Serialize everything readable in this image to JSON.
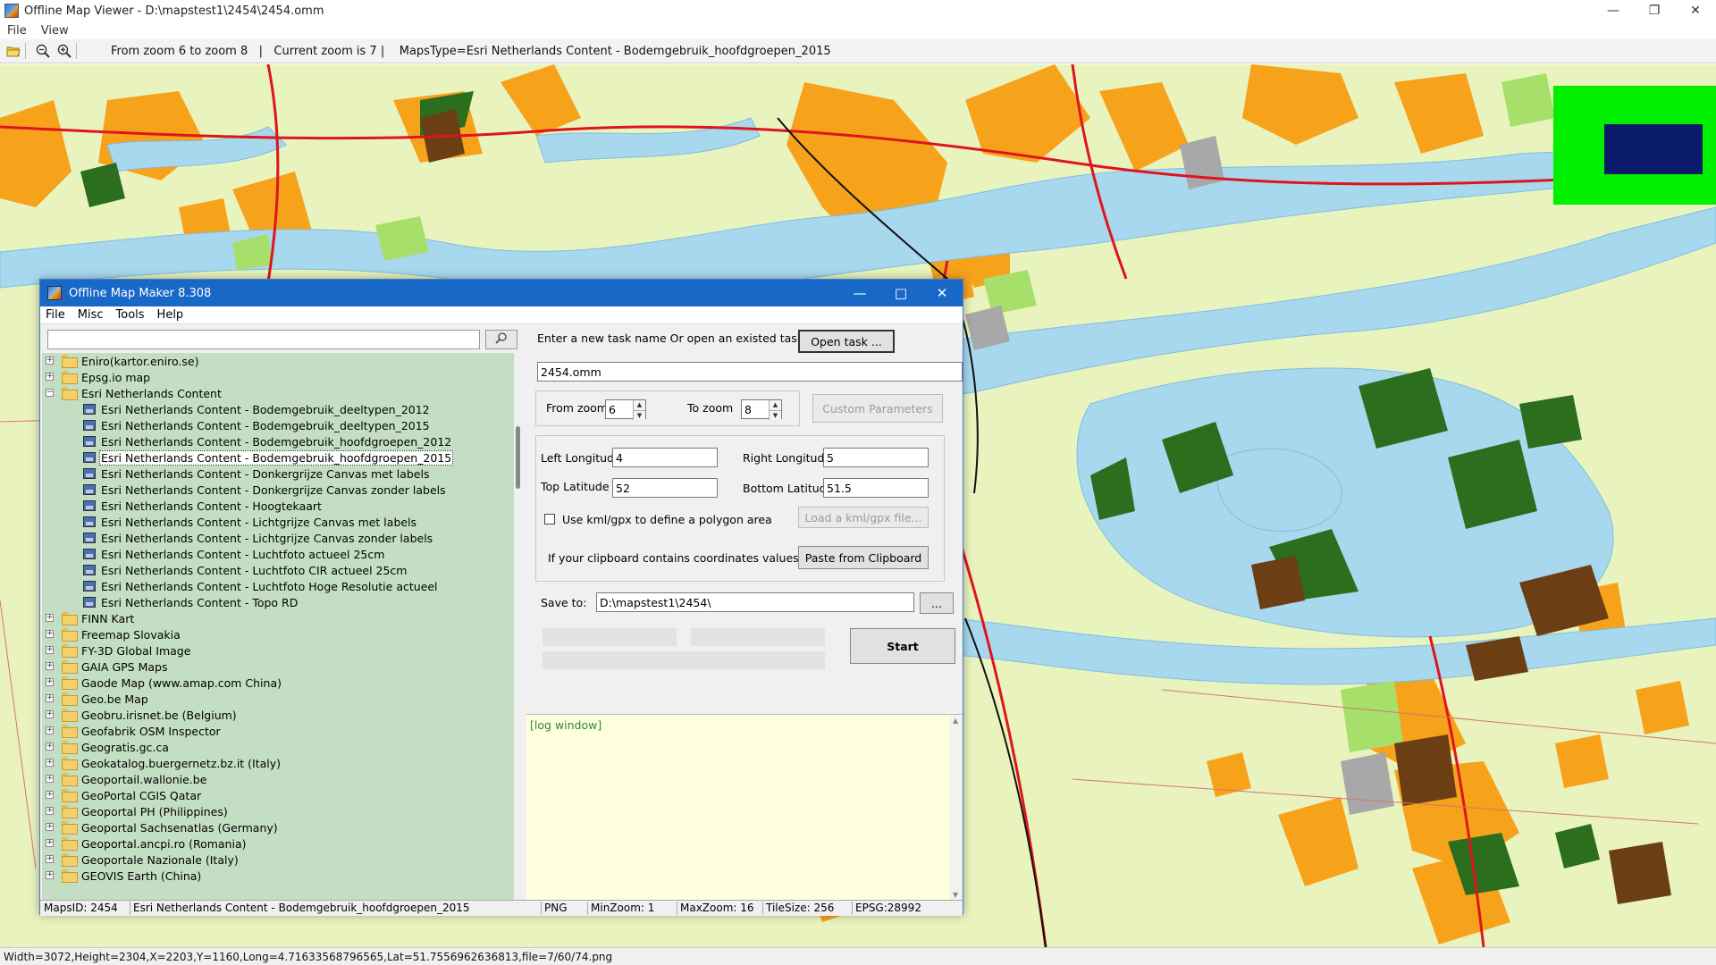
{
  "viewer": {
    "title": "Offline Map Viewer - D:\\mapstest1\\2454\\2454.omm",
    "menu": [
      "File",
      "View"
    ],
    "toolbar_info": "From zoom 6 to zoom 8   |   Current zoom is 7 |    MapsType=Esri Netherlands Content - Bodemgebruik_hoofdgroepen_2015",
    "statusbar": "Width=3072,Height=2304,X=2203,Y=1160,Long=4.71633568796565,Lat=51.7556962636813,file=7/60/74.png",
    "icons": [
      "open-folder-icon",
      "zoom-out-icon",
      "zoom-in-icon"
    ]
  },
  "map_colors": {
    "background": "#e9f3bd",
    "water": "#a8d8ee",
    "urban": "#f7a21b",
    "forest": "#2a6e1e",
    "light_green": "#a6e06a",
    "brown": "#6b3e14",
    "grey": "#a8a8a8",
    "road_red": "#e0141e",
    "overview_green": "#00f000",
    "overview_blue": "#0a1a6a"
  },
  "dialog": {
    "title": "Offline Map Maker 8.308",
    "menu": [
      "File",
      "Misc",
      "Tools",
      "Help"
    ],
    "search": {
      "value": ""
    },
    "tree": [
      {
        "label": "Eniro(kartor.eniro.se)",
        "level": 0,
        "expanded": false
      },
      {
        "label": "Epsg.io map",
        "level": 0,
        "expanded": false
      },
      {
        "label": "Esri Netherlands Content",
        "level": 0,
        "expanded": true
      },
      {
        "label": "Esri Netherlands Content - Bodemgebruik_deeltypen_2012",
        "level": 1
      },
      {
        "label": "Esri Netherlands Content - Bodemgebruik_deeltypen_2015",
        "level": 1
      },
      {
        "label": "Esri Netherlands Content - Bodemgebruik_hoofdgroepen_2012",
        "level": 1
      },
      {
        "label": "Esri Netherlands Content - Bodemgebruik_hoofdgroepen_2015",
        "level": 1,
        "selected": true
      },
      {
        "label": "Esri Netherlands Content - Donkergrijze Canvas met labels",
        "level": 1
      },
      {
        "label": "Esri Netherlands Content - Donkergrijze Canvas zonder labels",
        "level": 1
      },
      {
        "label": "Esri Netherlands Content - Hoogtekaart",
        "level": 1
      },
      {
        "label": "Esri Netherlands Content - Lichtgrijze Canvas met labels",
        "level": 1
      },
      {
        "label": "Esri Netherlands Content - Lichtgrijze Canvas zonder labels",
        "level": 1
      },
      {
        "label": "Esri Netherlands Content - Luchtfoto actueel 25cm",
        "level": 1
      },
      {
        "label": "Esri Netherlands Content - Luchtfoto CIR actueel 25cm",
        "level": 1
      },
      {
        "label": "Esri Netherlands Content - Luchtfoto Hoge Resolutie actueel",
        "level": 1
      },
      {
        "label": "Esri Netherlands Content - Topo RD",
        "level": 1
      },
      {
        "label": "FINN Kart",
        "level": 0
      },
      {
        "label": "Freemap Slovakia",
        "level": 0
      },
      {
        "label": "FY-3D Global Image",
        "level": 0
      },
      {
        "label": "GAIA GPS Maps",
        "level": 0
      },
      {
        "label": "Gaode Map (www.amap.com China)",
        "level": 0
      },
      {
        "label": "Geo.be Map",
        "level": 0
      },
      {
        "label": "Geobru.irisnet.be (Belgium)",
        "level": 0
      },
      {
        "label": "Geofabrik OSM Inspector",
        "level": 0
      },
      {
        "label": "Geogratis.gc.ca",
        "level": 0
      },
      {
        "label": "Geokatalog.buergernetz.bz.it (Italy)",
        "level": 0
      },
      {
        "label": "Geoportail.wallonie.be",
        "level": 0
      },
      {
        "label": "GeoPortal CGIS Qatar",
        "level": 0
      },
      {
        "label": "Geoportal PH (Philippines)",
        "level": 0
      },
      {
        "label": "Geoportal Sachsenatlas (Germany)",
        "level": 0
      },
      {
        "label": "Geoportal.ancpi.ro (Romania)",
        "level": 0
      },
      {
        "label": "Geoportale Nazionale (Italy)",
        "level": 0
      },
      {
        "label": "GEOVIS Earth (China)",
        "level": 0
      }
    ],
    "form": {
      "task_prompt": "Enter a new task name Or open an existed task to continue:",
      "open_task_label": "Open task ...",
      "task_name": "2454.omm",
      "from_zoom_label": "From zoom",
      "from_zoom": "6",
      "to_zoom_label": "To zoom",
      "to_zoom": "8",
      "custom_params_label": "Custom Parameters",
      "left_lon_label": "Left Longitude",
      "left_lon": "4",
      "right_lon_label": "Right Longitude",
      "right_lon": "5",
      "top_lat_label": "Top Latitude",
      "top_lat": "52",
      "bottom_lat_label": "Bottom Latitude",
      "bottom_lat": "51.5",
      "kml_label": "Use kml/gpx to define a polygon area",
      "load_kml_label": "Load a kml/gpx file...",
      "clipboard_prompt": "If your clipboard contains coordinates values:",
      "paste_label": "Paste from Clipboard",
      "save_to_label": "Save to:",
      "save_to": "D:\\mapstest1\\2454\\",
      "browse_label": "...",
      "start_label": "Start"
    },
    "log": "[log window]",
    "status": {
      "maps_id": "MapsID: 2454",
      "maps_name": "Esri Netherlands Content - Bodemgebruik_hoofdgroepen_2015",
      "format": "PNG",
      "min_zoom": "MinZoom: 1",
      "max_zoom": "MaxZoom: 16",
      "tile_size": "TileSize: 256",
      "epsg": "EPSG:28992"
    }
  }
}
